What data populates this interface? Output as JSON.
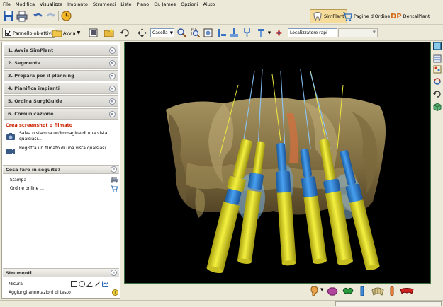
{
  "menu": [
    "File",
    "Modifica",
    "Visualizza",
    "Impianto",
    "Strumenti",
    "Liste",
    "Piano",
    "Dr. James",
    "Opzioni",
    "Aiuto"
  ],
  "modules": {
    "simplant": "SimPlant",
    "order": "Pagine d'Ordine",
    "dental": "DentalPlant"
  },
  "toolbar2": {
    "panel_label": "Pannello obiettivi",
    "start_label": "Avvia",
    "view_select": "Casella",
    "localizer_select": "Localizzatore rapi"
  },
  "sidebar": {
    "steps": [
      {
        "label": "1. Avvia SimPlant"
      },
      {
        "label": "2. Segmenta"
      },
      {
        "label": "3. Prepara per il planning"
      },
      {
        "label": "4. Pianifica impianti"
      },
      {
        "label": "5. Ordina SurgiGuide"
      },
      {
        "label": "6. Comunicazione"
      }
    ],
    "section_title": "Crea screenshot o filmato",
    "actions": [
      {
        "label": "Salva o stampa un'immagine di una vista qualsiasi..."
      },
      {
        "label": "Registra un filmato di una vista qualsiasi..."
      }
    ],
    "next_title": "Cosa fare in seguito?",
    "next_items": [
      {
        "label": "Stampa"
      },
      {
        "label": "Ordine online ..."
      }
    ],
    "tools_title": "Strumenti",
    "tools_items": [
      {
        "label": "Misura"
      },
      {
        "label": "Aggiungi annotazioni di testo"
      }
    ]
  },
  "colors": {
    "implant_yellow": "#e5e020",
    "implant_blue": "#2a7fd4",
    "bone": "#9d8a55",
    "viewport_bg": "#000000",
    "section_title": "#cc2200"
  }
}
